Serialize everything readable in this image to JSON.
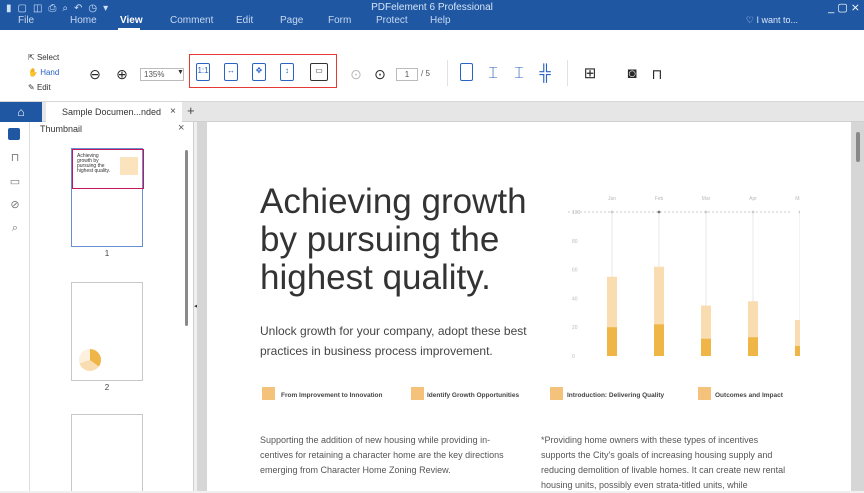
{
  "app": {
    "title": "PDFelement 6 Professional"
  },
  "menu": [
    "File",
    "Home",
    "View",
    "Comment",
    "Edit",
    "Page",
    "Form",
    "Protect",
    "Help"
  ],
  "i_want_to": "I want to...",
  "mode": {
    "select": "Select",
    "hand": "Hand",
    "edit": "Edit"
  },
  "zoom": {
    "value": "135%"
  },
  "pagenav": {
    "current": "1",
    "total": "/ 5"
  },
  "tab": {
    "label": "Sample Documen...nded"
  },
  "thumb": {
    "title": "Thumbnail",
    "pages": [
      "1",
      "2"
    ]
  },
  "doc": {
    "headline": "Achieving growth by pursuing the highest quality.",
    "subtitle": "Unlock growth for your company, adopt these best practices in business process improvement.",
    "captions": [
      "From Improvement to Innovation",
      "Identify Growth Opportunities",
      "Introduction: Delivering Quality",
      "Outcomes and Impact"
    ],
    "body_left": "Supporting the addition of new housing while providing in-centives for retaining a character home are the key directions emerging from Character Home Zoning Review.",
    "body_right": "*Providing home owners with these types of incentives supports the City's goals of increasing housing supply and reducing demolition of livable homes.  It can create new rental housing units, possibly even strata-titled units, while"
  },
  "chart_data": {
    "type": "bar",
    "categories": [
      "Jan",
      "Feb",
      "Mar",
      "Apr",
      "May"
    ],
    "series": [
      {
        "values": [
          55,
          62,
          35,
          38,
          25
        ]
      },
      {
        "values": [
          20,
          22,
          12,
          13,
          7
        ]
      }
    ],
    "yticks": [
      "0",
      "20",
      "40",
      "60",
      "80",
      "100"
    ],
    "ylim": [
      0,
      100
    ],
    "colors": {
      "light": "#f9ddb0",
      "dark": "#f0b547"
    }
  }
}
